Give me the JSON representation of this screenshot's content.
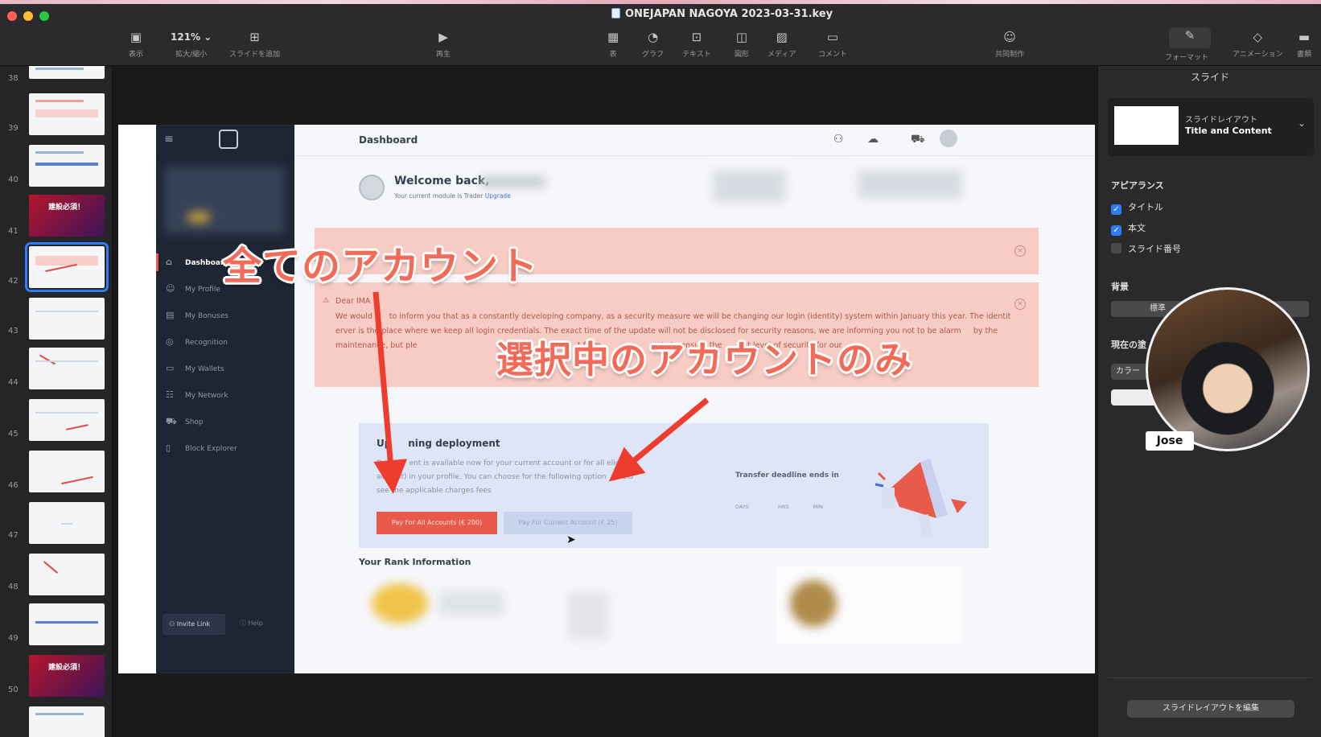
{
  "window": {
    "title": "ONEJAPAN NAGOYA 2023-03-31.key"
  },
  "toolbar": {
    "view_label": "表示",
    "zoom_value": "121%",
    "zoom_label": "拡大/縮小",
    "add_slide_label": "スライドを追加",
    "play_label": "再生",
    "table_label": "表",
    "chart_label": "グラフ",
    "text_label": "テキスト",
    "shape_label": "図形",
    "media_label": "メディア",
    "comment_label": "コメント",
    "collaborate_label": "共同制作",
    "format_label": "フォーマット",
    "animate_label": "アニメーション",
    "document_label": "書類"
  },
  "navigator": {
    "slides": [
      {
        "num": "38"
      },
      {
        "num": "39"
      },
      {
        "num": "40"
      },
      {
        "num": "41"
      },
      {
        "num": "42"
      },
      {
        "num": "43"
      },
      {
        "num": "44"
      },
      {
        "num": "45"
      },
      {
        "num": "46"
      },
      {
        "num": "47"
      },
      {
        "num": "48"
      },
      {
        "num": "49"
      },
      {
        "num": "50"
      }
    ],
    "thumb_41_text": "建設必須！",
    "thumb_50_text": "建設必須！"
  },
  "slide": {
    "dashboard": {
      "header_title": "Dashboard",
      "welcome": "Welcome back,",
      "module_text": "Your current module is Trader",
      "upgrade_link": "Upgrade",
      "nav": [
        {
          "label": "Dashboard"
        },
        {
          "label": "My Profile"
        },
        {
          "label": "My Bonuses"
        },
        {
          "label": "Recognition"
        },
        {
          "label": "My Wallets"
        },
        {
          "label": "My Network"
        },
        {
          "label": "Shop"
        },
        {
          "label": "Block Explorer"
        }
      ],
      "invite_link": "Invite Link",
      "help": "Help",
      "notice_greeting": "Dear IMA",
      "notice_text": "We would l     to inform you that as a constantly developing company, as a security measure we will be changing our login (identity) system within January this year. The identit     erver is the place where we keep all login credentials. The exact time of the update will not be disclosed for security reasons, we are informing you not to be alarm     by the maintenance, but ple                                                                  t from                       ets to ensure the       est level of security for our",
      "deployment_title": "Up     ning deployment",
      "deployment_desc": "Deplo     ent is available now for your current account or for all eligible ac     nt) in your profile. You can choose for the following option     belo     see the applicable charges fees",
      "btn_all": "Pay For All Accounts (€ 200)",
      "btn_current": "Pay For Current Account (€ 25)",
      "transfer_deadline": "Transfer deadline ends in",
      "countdown_units": [
        "DAYS",
        "HRS",
        "MIN"
      ],
      "rank_title": "Your Rank Information"
    },
    "annotations": {
      "all_accounts": "全てのアカウント",
      "current_only": "選択中のアカウントのみ"
    }
  },
  "inspector": {
    "tab": "スライド",
    "layout_label": "スライドレイアウト",
    "layout_value": "Title and Content",
    "appearance_header": "アピアランス",
    "title_check": "タイトル",
    "body_check": "本文",
    "slide_number_check": "スライド番号",
    "background_header": "背景",
    "background_value": "標準",
    "current_header": "現在の塗",
    "color_label": "カラー",
    "edit_layout_button": "スライドレイアウトを編集"
  },
  "webcam": {
    "name": "Jose"
  },
  "colors": {
    "accent": "#2f7cf6",
    "annotation_red": "#f26a58",
    "button_red": "#e85a4a"
  }
}
